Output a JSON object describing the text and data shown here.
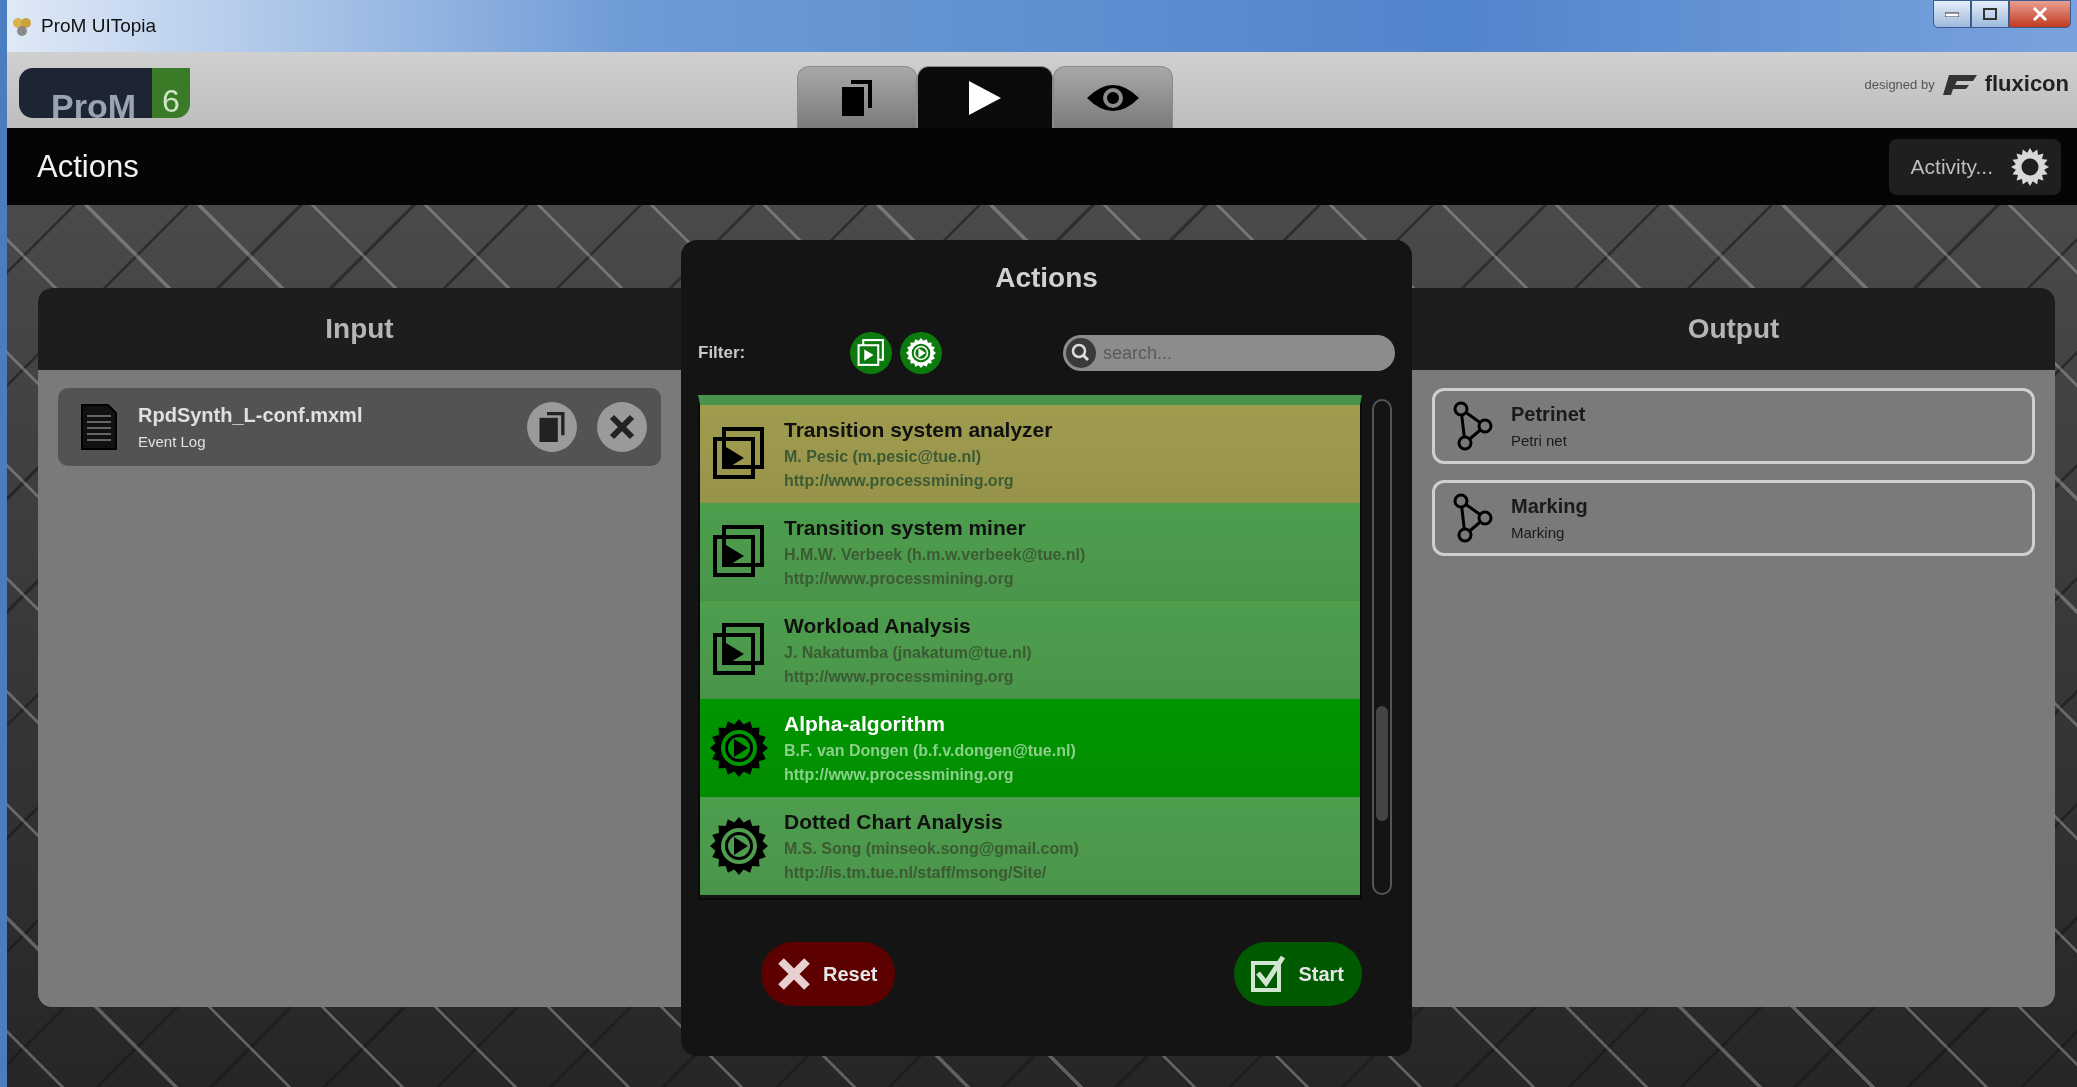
{
  "window": {
    "title": "ProM UITopia"
  },
  "logo": {
    "name": "ProM",
    "version": "6"
  },
  "tabs": [
    {
      "kind": "workspace",
      "selected": false
    },
    {
      "kind": "actions",
      "selected": true
    },
    {
      "kind": "view",
      "selected": false
    }
  ],
  "credit": {
    "prefix": "designed by",
    "brand": "fluxicon"
  },
  "page_title": "Actions",
  "activity": {
    "label": "Activity..."
  },
  "input": {
    "title": "Input",
    "items": [
      {
        "name": "RpdSynth_L-conf.mxml",
        "type": "Event Log"
      }
    ]
  },
  "dialog": {
    "title": "Actions",
    "filter_label": "Filter:",
    "filters": [
      {
        "kind": "stack",
        "on": true
      },
      {
        "kind": "gear",
        "on": true
      }
    ],
    "search": {
      "placeholder": "search..."
    },
    "actions": [
      {
        "kind": "stack",
        "name": "Transition system analyzer",
        "author": "M. Pesic (m.pesic@tue.nl)",
        "url": "http://www.processmining.org",
        "color": "#a09c4e",
        "selected": false
      },
      {
        "kind": "stack",
        "name": "Transition system miner",
        "author": "H.M.W. Verbeek (h.m.w.verbeek@tue.nl)",
        "url": "http://www.processmining.org",
        "color": "#4e9e4e",
        "selected": false
      },
      {
        "kind": "stack",
        "name": "Workload Analysis",
        "author": "J. Nakatumba (jnakatum@tue.nl)",
        "url": "http://www.processmining.org",
        "color": "#4e9e4e",
        "selected": false
      },
      {
        "kind": "gear",
        "name": "Alpha-algorithm",
        "author": "B.F. van Dongen (b.f.v.dongen@tue.nl)",
        "url": "http://www.processmining.org",
        "color": "#009600",
        "selected": true
      },
      {
        "kind": "gear",
        "name": "Dotted Chart Analysis",
        "author": "M.S. Song (minseok.song@gmail.com)",
        "url": "http://is.tm.tue.nl/staff/msong/Site/",
        "color": "#4e9e4e",
        "selected": false
      }
    ],
    "buttons": [
      {
        "kind": "reset",
        "label": "Reset"
      },
      {
        "kind": "start",
        "label": "Start"
      }
    ]
  },
  "output": {
    "title": "Output",
    "items": [
      {
        "name": "Petrinet",
        "type": "Petri net"
      },
      {
        "name": "Marking",
        "type": "Marking"
      }
    ]
  }
}
